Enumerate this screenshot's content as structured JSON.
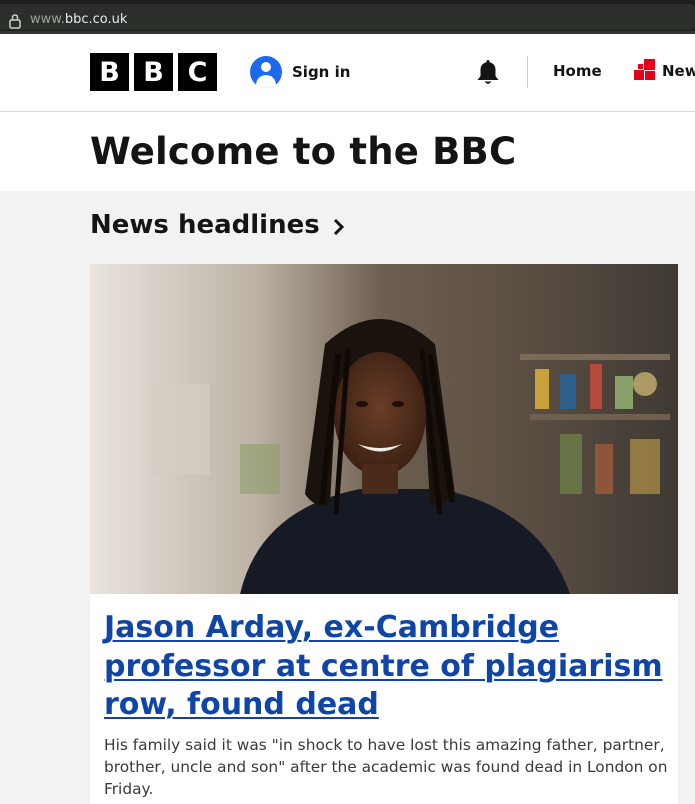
{
  "browser": {
    "url_prefix": "www.",
    "url_domain": "bbc.co.uk"
  },
  "header": {
    "logo_letters": [
      "B",
      "B",
      "C"
    ],
    "sign_in_label": "Sign in",
    "nav_home_label": "Home",
    "nav_news_label": "News"
  },
  "welcome": {
    "title": "Welcome to the BBC"
  },
  "section": {
    "title": "News headlines"
  },
  "lead_story": {
    "headline": "Jason Arday, ex-Cambridge professor at centre of plagiarism row, found dead",
    "summary": "His family said it was \"in shock to have lost this amazing father, partner, brother, uncle and son\" after the academic was found dead in London on Friday."
  },
  "colors": {
    "accent_blue": "#1c69ee",
    "headline_link": "#1045a8",
    "news_red": "#e4001b"
  }
}
